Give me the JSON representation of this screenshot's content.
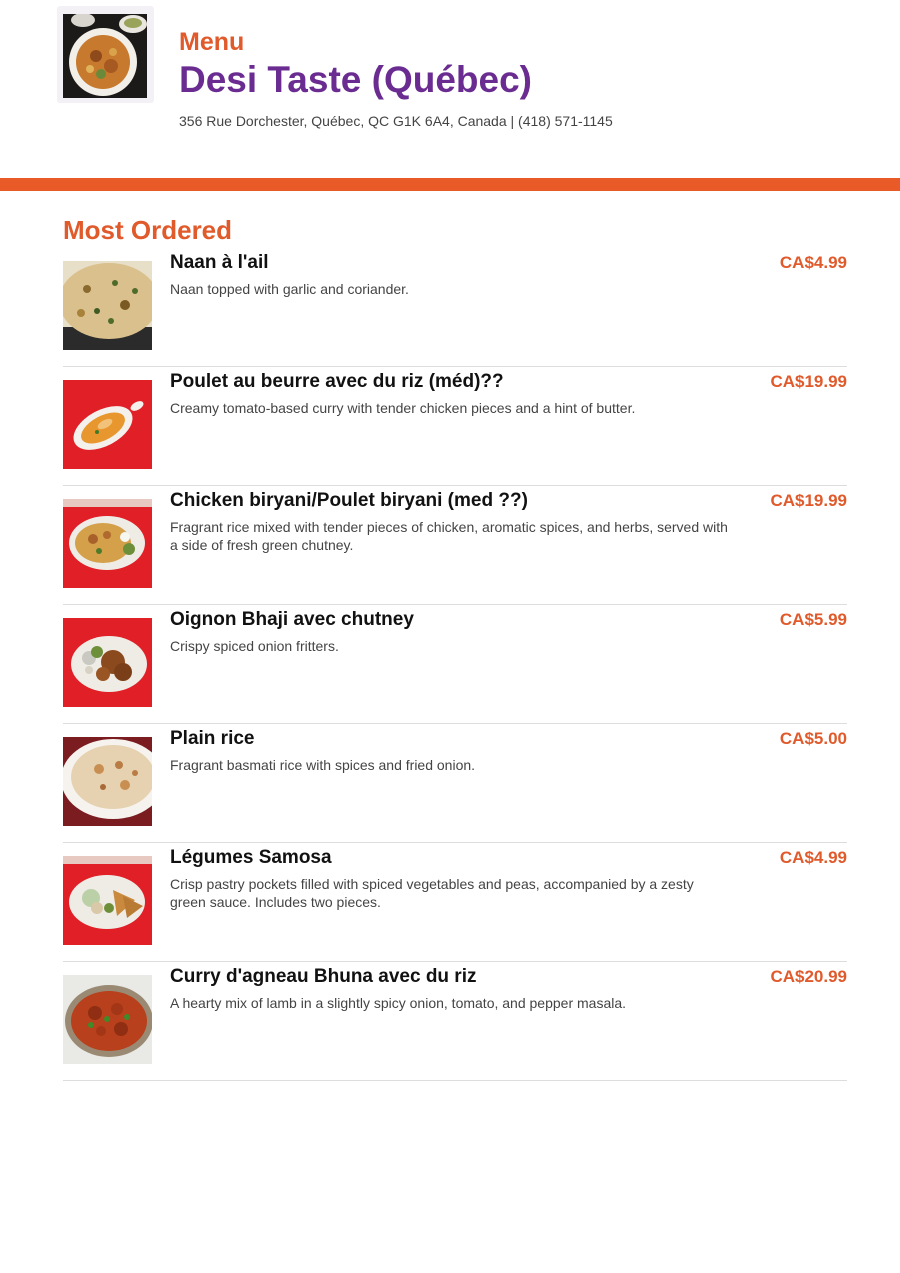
{
  "header": {
    "menu_label": "Menu",
    "restaurant_name": "Desi Taste (Québec)",
    "address": "356 Rue Dorchester, Québec, QC G1K 6A4, Canada | (418) 571-1145",
    "logo_icon": "food-plate-photo"
  },
  "colors": {
    "accent": "#e05a2b",
    "title": "#6a2c91",
    "bar": "#e85a28"
  },
  "section": {
    "title": "Most Ordered"
  },
  "items": [
    {
      "name": "Naan à l'ail",
      "description": "Naan topped with garlic and coriander.",
      "price": "CA$4.99",
      "image": "garlic-naan-photo"
    },
    {
      "name": "Poulet au beurre avec du riz (méd)??",
      "description": "Creamy tomato-based curry with tender chicken pieces and a hint of butter.",
      "price": "CA$19.99",
      "image": "butter-chicken-photo"
    },
    {
      "name": "Chicken biryani/Poulet biryani (med ??)",
      "description": "Fragrant rice mixed with tender pieces of chicken, aromatic spices, and herbs, served with a side of fresh green chutney.",
      "price": "CA$19.99",
      "image": "chicken-biryani-photo"
    },
    {
      "name": "Oignon Bhaji avec chutney",
      "description": "Crispy spiced onion fritters.",
      "price": "CA$5.99",
      "image": "onion-bhaji-photo"
    },
    {
      "name": "Plain rice",
      "description": "Fragrant basmati rice with spices and fried onion.",
      "price": "CA$5.00",
      "image": "plain-rice-photo"
    },
    {
      "name": "Légumes Samosa",
      "description": "Crisp pastry pockets filled with spiced vegetables and peas, accompanied by a zesty green sauce. Includes two pieces.",
      "price": "CA$4.99",
      "image": "vegetable-samosa-photo"
    },
    {
      "name": "Curry d'agneau Bhuna avec du riz",
      "description": "A hearty mix of lamb in a slightly spicy onion, tomato, and pepper masala.",
      "price": "CA$20.99",
      "image": "lamb-bhuna-photo"
    }
  ]
}
